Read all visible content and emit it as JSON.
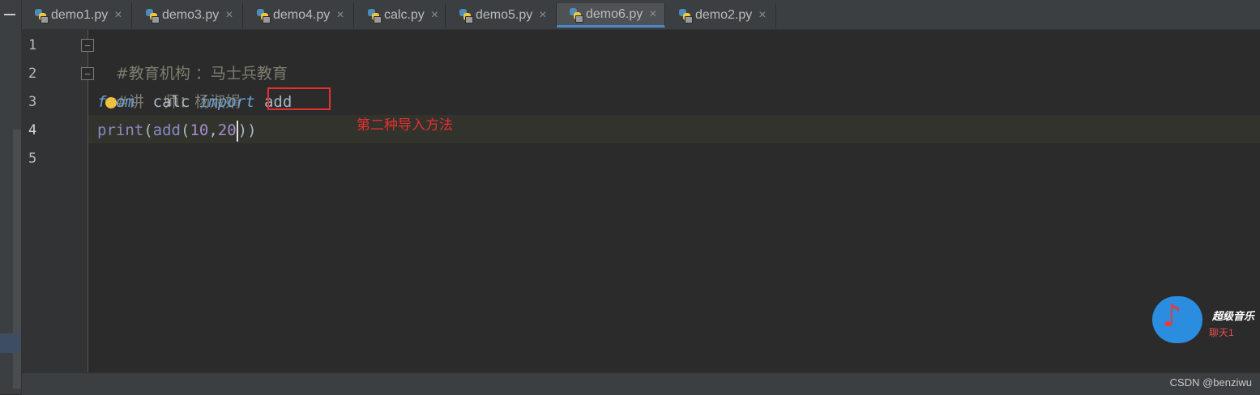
{
  "tabs": [
    {
      "label": "demo1.py",
      "active": false
    },
    {
      "label": "demo3.py",
      "active": false
    },
    {
      "label": "demo4.py",
      "active": false
    },
    {
      "label": "calc.py",
      "active": false
    },
    {
      "label": "demo5.py",
      "active": false
    },
    {
      "label": "demo6.py",
      "active": true
    },
    {
      "label": "demo2.py",
      "active": false
    }
  ],
  "close_glyph": "×",
  "line_numbers": [
    "1",
    "2",
    "3",
    "4",
    "5"
  ],
  "code": {
    "line1": "#教育机构 ：马士兵教育",
    "line2": "#讲    师：杨淑娟",
    "line3": {
      "kw_from": "from",
      "module": "calc",
      "kw_import": "import",
      "name": "add"
    },
    "line4": {
      "fn_print": "print",
      "p1": "(",
      "fn_add": "add",
      "p2": "(",
      "num1": "10",
      "comma": ",",
      "num2": "20",
      "close": "))"
    }
  },
  "annotation": "第二种导入方法",
  "widget": {
    "title": "超级音乐",
    "subtitle": "聊天1",
    "note_glyph": "♪"
  },
  "watermark": "CSDN @benziwu",
  "colors": {
    "accent_tab": "#4a88c7",
    "annotation": "#e53030",
    "keyword": "#6aa0d3",
    "builtin": "#8888c6",
    "number": "#a58ec9"
  }
}
